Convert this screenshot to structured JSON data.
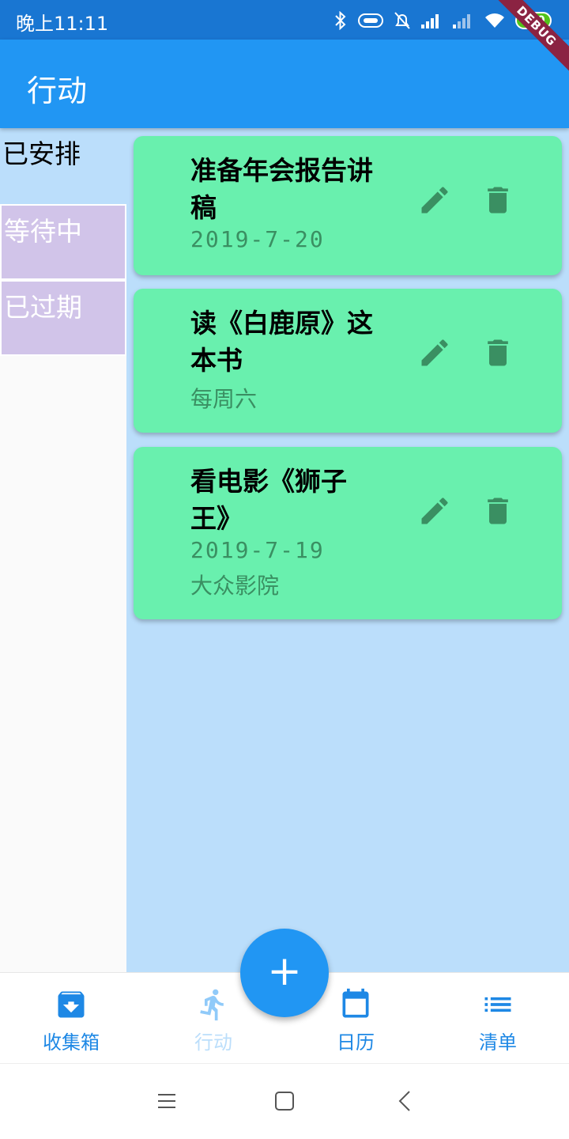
{
  "status_bar": {
    "time": "晚上11:11",
    "battery": "100"
  },
  "debug_banner": "DEBUG",
  "app_bar": {
    "title": "行动"
  },
  "side_menu": {
    "items": [
      {
        "label": "已安排",
        "selected": true
      },
      {
        "label": "等待中",
        "selected": false
      },
      {
        "label": "已过期",
        "selected": false
      }
    ]
  },
  "tasks": [
    {
      "title": "准备年会报告讲稿",
      "date": "2019-7-20",
      "location": ""
    },
    {
      "title": "读《白鹿原》这本书",
      "repeat": "每周六"
    },
    {
      "title": "看电影《狮子王》",
      "date": "2019-7-19",
      "location": "大众影院"
    }
  ],
  "bottom_nav": {
    "items": [
      {
        "label": "收集箱",
        "icon": "inbox-icon",
        "active": false
      },
      {
        "label": "行动",
        "icon": "run-icon",
        "active": true
      },
      {
        "label": "日历",
        "icon": "calendar-icon",
        "active": false
      },
      {
        "label": "清单",
        "icon": "list-icon",
        "active": false
      }
    ]
  },
  "fab": {
    "label": "+"
  },
  "colors": {
    "primary": "#2196f3",
    "status_bar": "#1976d2",
    "card": "#69f0ae",
    "main_bg": "#bbdefb",
    "side_pending": "#d1c4e9",
    "icon_dark": "#3a8f62"
  }
}
